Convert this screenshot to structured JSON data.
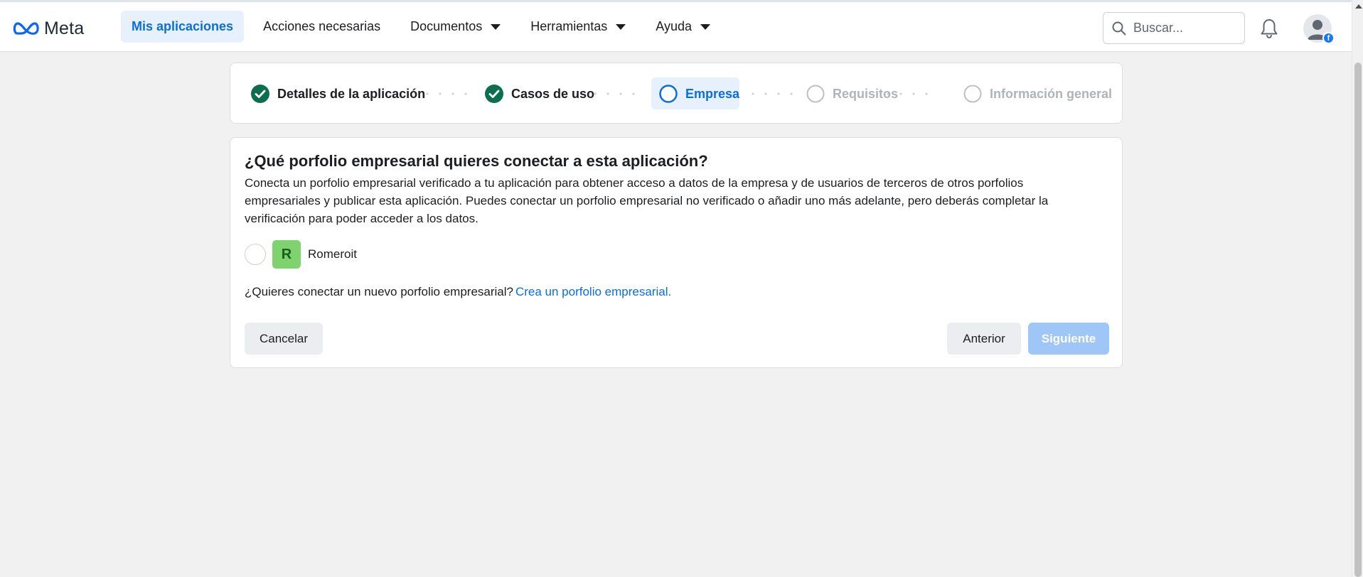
{
  "header": {
    "logo_text": "Meta",
    "nav": [
      {
        "label": "Mis aplicaciones",
        "active": true,
        "dropdown": false
      },
      {
        "label": "Acciones necesarias",
        "active": false,
        "dropdown": false
      },
      {
        "label": "Documentos",
        "active": false,
        "dropdown": true
      },
      {
        "label": "Herramientas",
        "active": false,
        "dropdown": true
      },
      {
        "label": "Ayuda",
        "active": false,
        "dropdown": true
      }
    ],
    "search": {
      "placeholder": "Buscar...",
      "icon": "search-icon"
    },
    "notifications_icon": "bell-icon",
    "avatar_icon": "user-avatar-icon",
    "avatar_badge": "f"
  },
  "stepper": {
    "steps": [
      {
        "label": "Detalles de la aplicación",
        "state": "done"
      },
      {
        "label": "Casos de uso",
        "state": "done"
      },
      {
        "label": "Empresa",
        "state": "current"
      },
      {
        "label": "Requisitos",
        "state": "pending"
      },
      {
        "label": "Información general",
        "state": "pending"
      }
    ]
  },
  "main": {
    "title": "¿Qué porfolio empresarial quieres conectar a esta aplicación?",
    "description": "Conecta un porfolio empresarial verificado a tu aplicación para obtener acceso a datos de la empresa y de usuarios de terceros de otros porfolios empresariales y publicar esta aplicación. Puedes conectar un porfolio empresarial no verificado o añadir uno más adelante, pero deberás completar la verificación para poder acceder a los datos.",
    "options": [
      {
        "initial": "R",
        "name": "Romeroit",
        "selected": false
      }
    ],
    "new_portfolio_text": "¿Quieres conectar un nuevo porfolio empresarial?",
    "new_portfolio_link": "Crea un porfolio empresarial.",
    "buttons": {
      "cancel": "Cancelar",
      "previous": "Anterior",
      "next": "Siguiente"
    }
  },
  "colors": {
    "accent": "#0a6de0",
    "done_check": "#0a6e4f",
    "background": "#f1f1f1",
    "next_disabled": "#9ec6f7"
  }
}
